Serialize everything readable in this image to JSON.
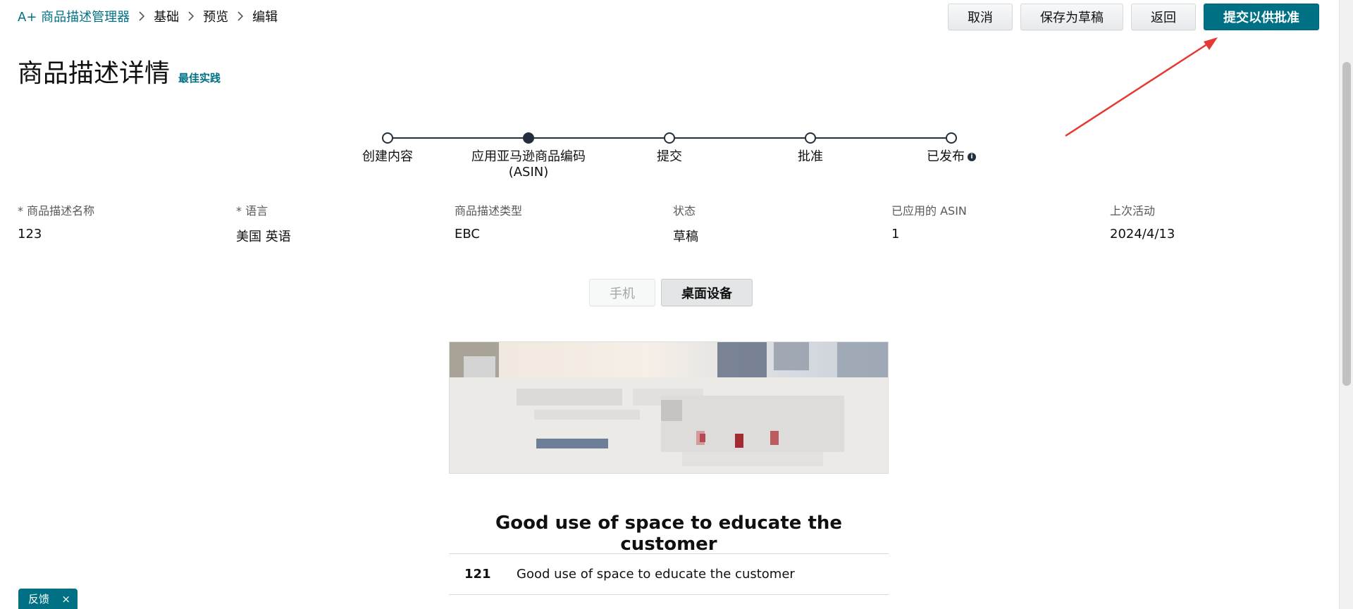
{
  "breadcrumb": {
    "items": [
      "A+ 商品描述管理器",
      "基础",
      "预览",
      "编辑"
    ]
  },
  "actions": {
    "cancel": "取消",
    "save_draft": "保存为草稿",
    "back": "返回",
    "submit": "提交以供批准"
  },
  "title": {
    "text": "商品描述详情",
    "best_practices": "最佳实践"
  },
  "stepper": {
    "steps": [
      "创建内容",
      "应用亚马逊商品编码\n(ASIN)",
      "提交",
      "批准",
      "已发布"
    ],
    "active_index": 1
  },
  "details": {
    "labels": [
      "* 商品描述名称",
      "* 语言",
      "商品描述类型",
      "状态",
      "已应用的 ASIN",
      "上次活动"
    ],
    "values": [
      "123",
      "美国 英语",
      "EBC",
      "草稿",
      "1",
      "2024/4/13"
    ]
  },
  "device_toggle": {
    "mobile": "手机",
    "desktop": "桌面设备"
  },
  "module": {
    "heading": "Good use of space to educate the customer",
    "row_number": "121",
    "row_text": "Good use of space to educate the customer"
  },
  "feedback": {
    "label": "反馈",
    "close": "×"
  },
  "colors": {
    "accent": "#007185",
    "annotation": "#e53935"
  }
}
